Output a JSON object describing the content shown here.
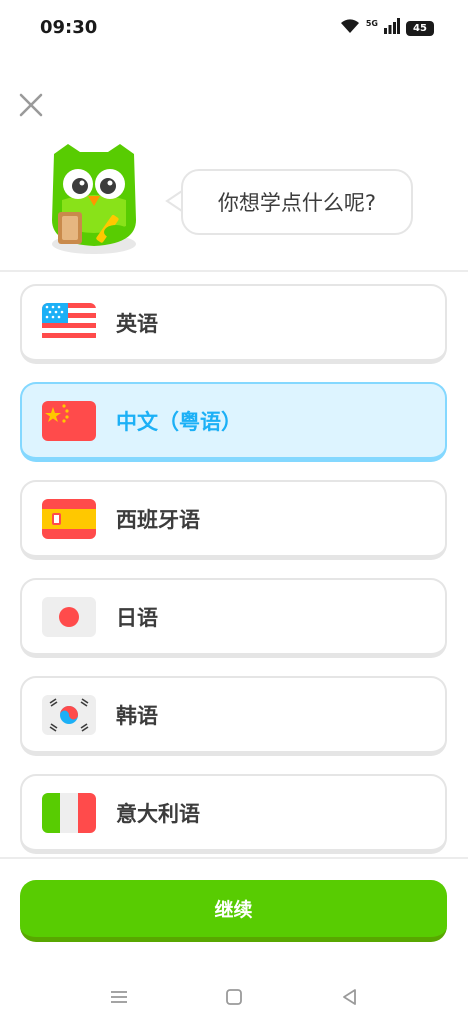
{
  "status_bar": {
    "time": "09:30",
    "network": "5G",
    "battery": "45",
    "icons": [
      "wifi-icon",
      "signal-icon",
      "battery-icon"
    ]
  },
  "header": {
    "close_icon": "close-icon",
    "mascot": "owl-mascot",
    "prompt": "你想学点什么呢?"
  },
  "languages": [
    {
      "label": "英语",
      "flag": "us-flag-icon",
      "selected": false
    },
    {
      "label": "中文（粤语）",
      "flag": "china-flag-icon",
      "selected": true
    },
    {
      "label": "西班牙语",
      "flag": "spain-flag-icon",
      "selected": false
    },
    {
      "label": "日语",
      "flag": "japan-flag-icon",
      "selected": false
    },
    {
      "label": "韩语",
      "flag": "korea-flag-icon",
      "selected": false
    },
    {
      "label": "意大利语",
      "flag": "italy-flag-icon",
      "selected": false
    }
  ],
  "continue_button": {
    "label": "继续"
  },
  "nav_bar": {
    "icons": [
      "menu-icon",
      "home-icon",
      "back-icon"
    ]
  },
  "colors": {
    "accent_green": "#58cc02",
    "selected_bg": "#ddf4ff",
    "selected_border": "#84d8ff",
    "selected_text": "#1cb0f6"
  }
}
